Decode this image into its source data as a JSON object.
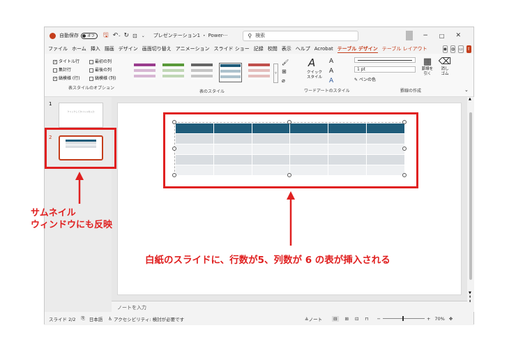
{
  "titlebar": {
    "autosave_label": "自動保存",
    "autosave_state": "オフ",
    "filename": "プレゼンテーション1 ・ Power···",
    "search_placeholder": "検索"
  },
  "menu": [
    "ファイル",
    "ホーム",
    "挿入",
    "描画",
    "デザイン",
    "画面切り替え",
    "アニメーション",
    "スライド ショー",
    "記録",
    "校閲",
    "表示",
    "ヘルプ",
    "Acrobat",
    "テーブル デザイン",
    "テーブル レイアウト"
  ],
  "ribbon": {
    "style_options": {
      "col1": [
        "タイトル行",
        "集計行",
        "縞模様 (行)"
      ],
      "col2": [
        "最初の列",
        "最後の列",
        "縞模様 (列)"
      ],
      "checked": [
        true,
        false,
        true,
        false,
        false,
        false
      ],
      "group_label": "表スタイルのオプション"
    },
    "table_styles_label": "表のスタイル",
    "wordart": {
      "quick_styles": "クイック\nスタイル",
      "group_label": "ワードアートのスタイル"
    },
    "borders": {
      "pen_weight": "1 pt",
      "pen_color": "ペンの色",
      "draw_table": "罫線を\n引く",
      "eraser": "消し\nゴム",
      "group_label": "罫線の作成"
    }
  },
  "thumbnails": {
    "slide1_num": "1",
    "slide1_text": "クリックしてタイトルを入力",
    "slide2_num": "2"
  },
  "table": {
    "rows": 5,
    "cols": 6,
    "header_color": "#1f5c7a",
    "band_color": "#d9dde1",
    "body_color": "#eef0f2"
  },
  "notes_placeholder": "ノートを入力",
  "status": {
    "slide": "スライド 2/2",
    "lang": "日本語",
    "accessibility": "アクセシビリティ: 検討が必要です",
    "notes": "ノート",
    "zoom": "70%"
  },
  "annotations": {
    "thumb_note": "サムネイル\nウィンドウにも反映",
    "table_note": "白紙のスライドに、行数が5、列数が 6 の表が挿入される"
  }
}
